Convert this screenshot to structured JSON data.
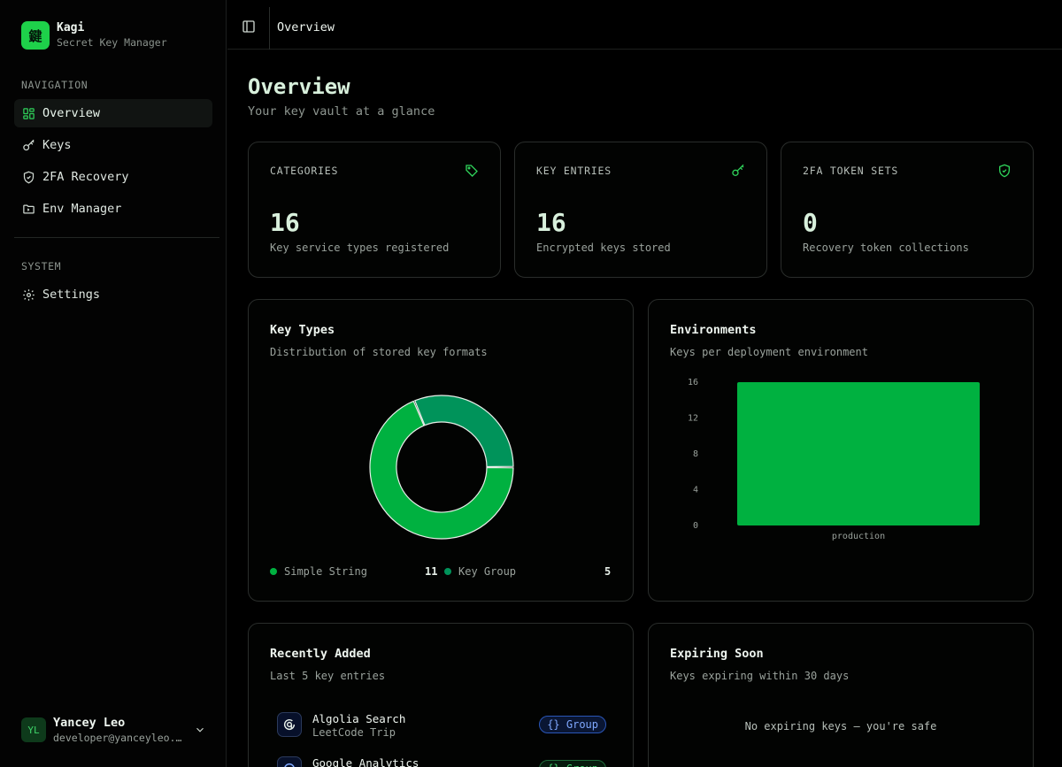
{
  "brand": {
    "logo_glyph": "鍵",
    "name": "Kagi",
    "subtitle": "Secret Key Manager"
  },
  "sidebar": {
    "nav_label": "NAVIGATION",
    "items": [
      {
        "label": "Overview",
        "icon": "dashboard-icon",
        "active": true
      },
      {
        "label": "Keys",
        "icon": "key-icon"
      },
      {
        "label": "2FA Recovery",
        "icon": "shield-check-icon"
      },
      {
        "label": "Env Manager",
        "icon": "folder-icon"
      }
    ],
    "system_label": "SYSTEM",
    "system_items": [
      {
        "label": "Settings",
        "icon": "gear-icon"
      }
    ]
  },
  "user": {
    "initials": "YL",
    "name": "Yancey Leo",
    "email": "developer@yanceyleo.com"
  },
  "header": {
    "title": "Overview"
  },
  "page": {
    "title": "Overview",
    "subtitle": "Your key vault at a glance"
  },
  "stats": [
    {
      "label": "CATEGORIES",
      "value": "16",
      "desc": "Key service types registered",
      "icon": "tag-icon"
    },
    {
      "label": "KEY ENTRIES",
      "value": "16",
      "desc": "Encrypted keys stored",
      "icon": "key-icon"
    },
    {
      "label": "2FA TOKEN SETS",
      "value": "0",
      "desc": "Recovery token collections",
      "icon": "shield-check-icon"
    }
  ],
  "key_types": {
    "title": "Key Types",
    "subtitle": "Distribution of stored key formats"
  },
  "environments": {
    "title": "Environments",
    "subtitle": "Keys per deployment environment"
  },
  "colors": {
    "accent": "#00b140",
    "accent_dark": "#00935a",
    "brand": "#1ed14a"
  },
  "chart_data": [
    {
      "type": "pie",
      "variant": "donut",
      "series": [
        {
          "name": "Simple String",
          "value": 11,
          "color": "#00b140"
        },
        {
          "name": "Key Group",
          "value": 5,
          "color": "#00935a"
        }
      ]
    },
    {
      "type": "bar",
      "categories": [
        "production"
      ],
      "values": [
        16
      ],
      "yticks": [
        0,
        4,
        8,
        12,
        16
      ],
      "ylim": [
        0,
        16
      ],
      "color": "#00b140"
    }
  ],
  "recent": {
    "title": "Recently Added",
    "subtitle": "Last 5 key entries",
    "items": [
      {
        "name": "Algolia Search",
        "category": "LeetCode Trip",
        "badge": "{} Group",
        "icon": "algolia-icon"
      },
      {
        "name": "Google Analytics",
        "category": "",
        "badge": "{} Group",
        "icon": "google-analytics-icon"
      }
    ]
  },
  "expiring": {
    "title": "Expiring Soon",
    "subtitle": "Keys expiring within 30 days",
    "empty": "No expiring keys — you're safe"
  }
}
